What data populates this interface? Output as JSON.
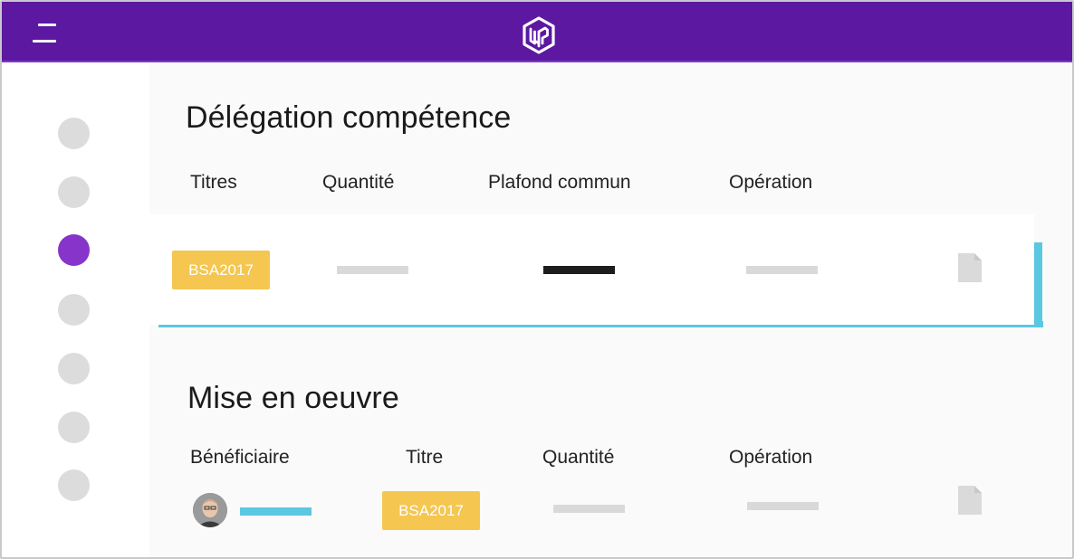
{
  "app": {
    "logo_icon": "wp-logo-icon",
    "menu_icon": "hamburger-menu-icon",
    "brand_color": "#5c18a0"
  },
  "sidebar": {
    "items": [
      {
        "icon": "nav-dot-icon",
        "active": false
      },
      {
        "icon": "nav-dot-icon",
        "active": false
      },
      {
        "icon": "nav-dot-icon",
        "active": true
      },
      {
        "icon": "nav-dot-icon",
        "active": false
      },
      {
        "icon": "nav-dot-icon",
        "active": false
      },
      {
        "icon": "nav-dot-icon",
        "active": false
      },
      {
        "icon": "nav-dot-icon",
        "active": false
      }
    ],
    "active_color": "#8634c9",
    "inactive_color": "#dcdcdc"
  },
  "delegation": {
    "title": "Délégation compétence",
    "columns": [
      "Titres",
      "Quantité",
      "Plafond commun",
      "Opération"
    ],
    "row": {
      "titre": "BSA2017",
      "document_icon": "document-icon"
    }
  },
  "mise_en_oeuvre": {
    "title": "Mise en oeuvre",
    "columns": [
      "Bénéficiaire",
      "Titre",
      "Quantité",
      "Opération"
    ],
    "row": {
      "avatar_icon": "user-avatar",
      "titre": "BSA2017",
      "document_icon": "document-icon"
    }
  },
  "colors": {
    "badge": "#f5c650",
    "accent": "#5bc8e1",
    "placeholder": "#d9d9d9"
  }
}
